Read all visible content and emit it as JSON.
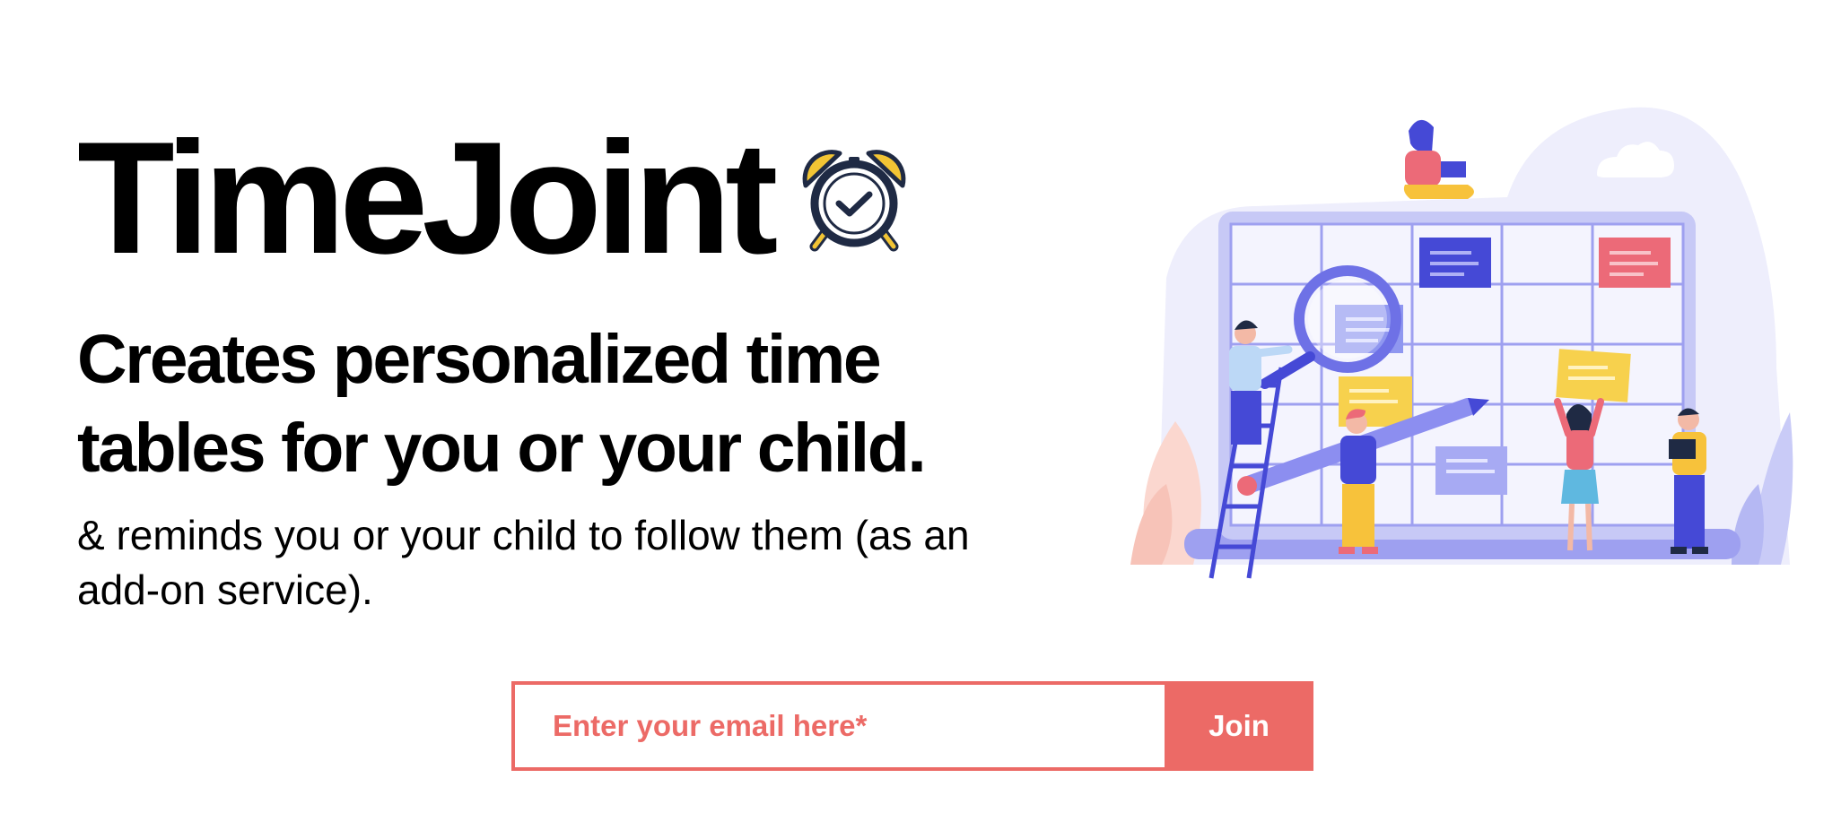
{
  "brand": {
    "title": "TimeJoint",
    "icon": "alarm-clock-check-icon"
  },
  "hero": {
    "headline": "Creates personalized time tables for you or your child.",
    "subtext": "& reminds you or your child to follow them (as an add-on service)."
  },
  "signup": {
    "email_placeholder": "Enter your email here*",
    "email_value": "",
    "join_label": "Join"
  },
  "illustration": {
    "subject": "team-planning-calendar-illustration"
  },
  "colors": {
    "accent": "#ec6a66",
    "text": "#000000",
    "illustration_primary": "#8c8ef0",
    "illustration_bg": "#eeeefc",
    "clock_yellow": "#f2c434",
    "clock_navy": "#1f2a44"
  }
}
